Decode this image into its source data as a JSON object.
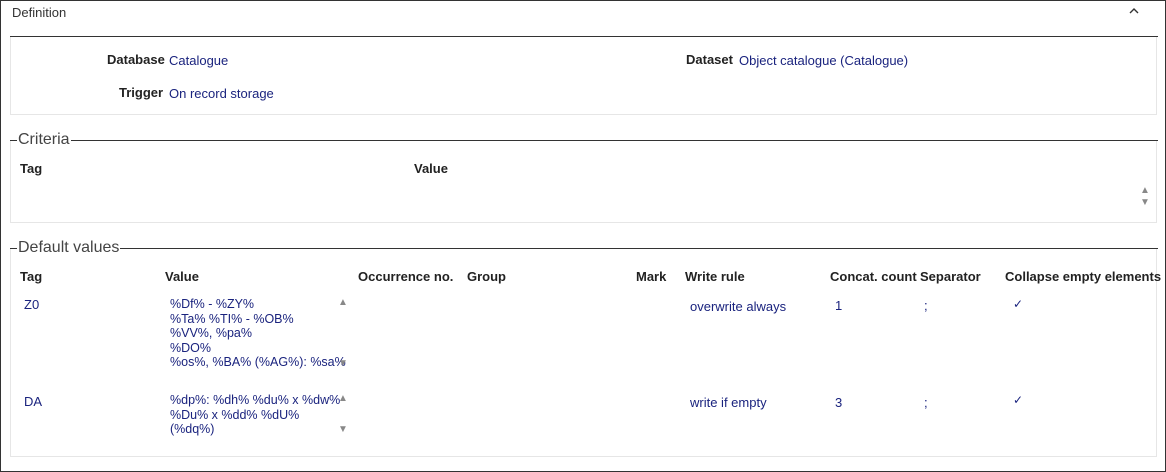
{
  "header": {
    "title": "Definition",
    "collapse_glyph": "^",
    "collapse_icon": "chevron-up-icon"
  },
  "definition": {
    "database_label": "Database",
    "database_value": "Catalogue",
    "dataset_label": "Dataset",
    "dataset_value": "Object catalogue (Catalogue)",
    "trigger_label": "Trigger",
    "trigger_value": "On record storage"
  },
  "criteria": {
    "legend": "Criteria",
    "columns": [
      "Tag",
      "Value"
    ],
    "scroll_up_glyph": "▲",
    "scroll_down_glyph": "▼"
  },
  "default_values": {
    "legend": "Default values",
    "columns": [
      "Tag",
      "Value",
      "Occurrence no.",
      "Group",
      "Mark",
      "Write rule",
      "Concat. count",
      "Separator",
      "Collapse empty elements"
    ],
    "rows": [
      {
        "tag": "Z0",
        "value": "%Df% - %ZY%\n%Ta% %TI% - %OB%\n%VV%, %pa%\n%DO%\n%os%, %BA% (%AG%): %sa%",
        "occurrence": "",
        "group": "",
        "mark": "",
        "write_rule": "overwrite always",
        "concat_count": "1",
        "separator": ";",
        "collapse": "✓"
      },
      {
        "tag": "DA",
        "value": "%dp%: %dh% %du% x %dw%\n%Du% x %dd% %dU%\n(%dq%)",
        "occurrence": "",
        "group": "",
        "mark": "",
        "write_rule": "write if empty",
        "concat_count": "3",
        "separator": ";",
        "collapse": "✓"
      }
    ],
    "scroll_up_glyph": "▲",
    "scroll_down_glyph": "▼"
  },
  "colors": {
    "value_text": "#1a237e",
    "border": "#333333"
  }
}
